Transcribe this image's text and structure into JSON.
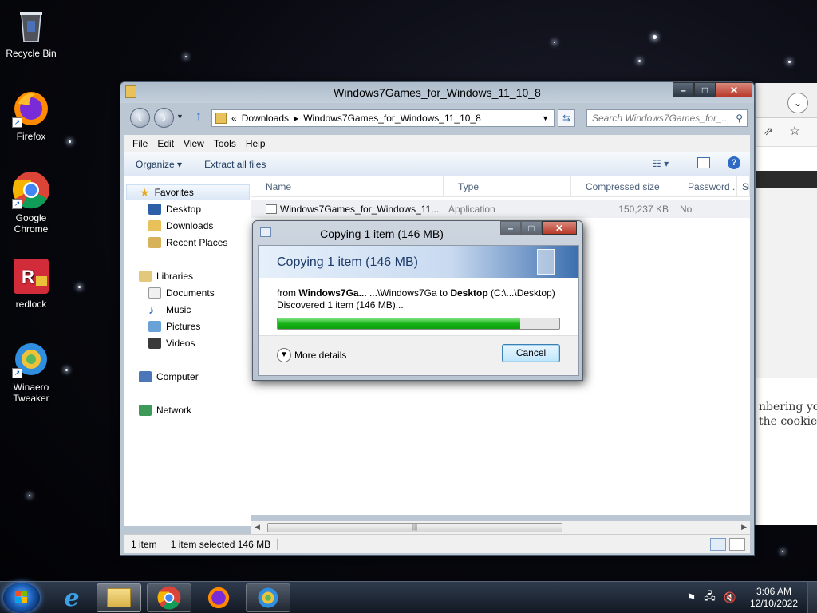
{
  "desktop": {
    "icons": [
      {
        "label": "Recycle Bin",
        "icon": "recycle-bin-icon"
      },
      {
        "label": "Firefox",
        "icon": "firefox-icon"
      },
      {
        "label": "Google\nChrome",
        "icon": "chrome-icon"
      },
      {
        "label": "redlock",
        "icon": "redlock-icon"
      },
      {
        "label": "Winaero\nTweaker",
        "icon": "winaero-icon"
      }
    ]
  },
  "background_browser": {
    "text_line1": "nbering you",
    "text_line2": "the cookie"
  },
  "explorer": {
    "title": "Windows7Games_for_Windows_11_10_8",
    "address": {
      "prefix": "«",
      "crumb1": "Downloads",
      "crumb2": "Windows7Games_for_Windows_11_10_8"
    },
    "search_placeholder": "Search Windows7Games_for_...",
    "menu": [
      "File",
      "Edit",
      "View",
      "Tools",
      "Help"
    ],
    "commands": {
      "organize": "Organize ▾",
      "extract": "Extract all files"
    },
    "nav": {
      "favorites": "Favorites",
      "desktop": "Desktop",
      "downloads": "Downloads",
      "recent": "Recent Places",
      "libraries": "Libraries",
      "documents": "Documents",
      "music": "Music",
      "pictures": "Pictures",
      "videos": "Videos",
      "computer": "Computer",
      "network": "Network"
    },
    "columns": [
      "Name",
      "Type",
      "Compressed size",
      "Password ...",
      "Si"
    ],
    "file": {
      "name": "Windows7Games_for_Windows_11...",
      "type": "Application",
      "size": "150,237 KB",
      "password": "No"
    },
    "status": {
      "count": "1 item",
      "selected": "1 item selected  146 MB"
    }
  },
  "copy_dialog": {
    "window_title": "Copying 1 item (146 MB)",
    "header": "Copying 1 item (146 MB)",
    "from_label": "from",
    "from_name": "Windows7Ga...",
    "from_path": "...\\Windows7Ga",
    "to_label": "to",
    "to_name": "Desktop",
    "to_path": "(C:\\...\\Desktop)",
    "discovered": "Discovered 1 item (146 MB)...",
    "progress_fraction": 0.86,
    "more_details": "More details",
    "cancel": "Cancel"
  },
  "taskbar": {
    "time": "3:06 AM",
    "date": "12/10/2022",
    "items": [
      "ie-icon",
      "explorer-icon",
      "chrome-icon",
      "firefox-icon",
      "winaero-icon"
    ]
  }
}
